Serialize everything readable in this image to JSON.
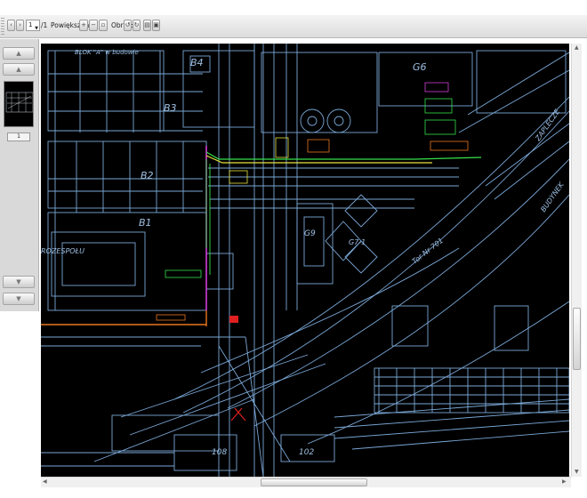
{
  "toolbar": {
    "page_value": "1",
    "page_total": "/1",
    "zoom_label": "Powiększenie:",
    "rotate_label": "Obróć:"
  },
  "sidebar": {
    "page_number": "1"
  },
  "drawing_labels": [
    {
      "text": "BLOK \"A\" w budowie"
    },
    {
      "text": "B4"
    },
    {
      "text": "B3"
    },
    {
      "text": "B2"
    },
    {
      "text": "B1"
    },
    {
      "text": "G6"
    },
    {
      "text": "G9"
    },
    {
      "text": "G7-1"
    },
    {
      "text": "Tor Nr 701"
    },
    {
      "text": "ROZESPOŁU"
    },
    {
      "text": "ZAPLECZE"
    },
    {
      "text": "BUDYNEK"
    },
    {
      "text": "102"
    },
    {
      "text": "108"
    }
  ],
  "colors": {
    "background": "#000000",
    "lines": "#7aa7d6",
    "green": "#35e04a",
    "yellow": "#e6e23c",
    "magenta": "#d23cd8",
    "orange": "#e8761e",
    "red": "#e02020"
  }
}
